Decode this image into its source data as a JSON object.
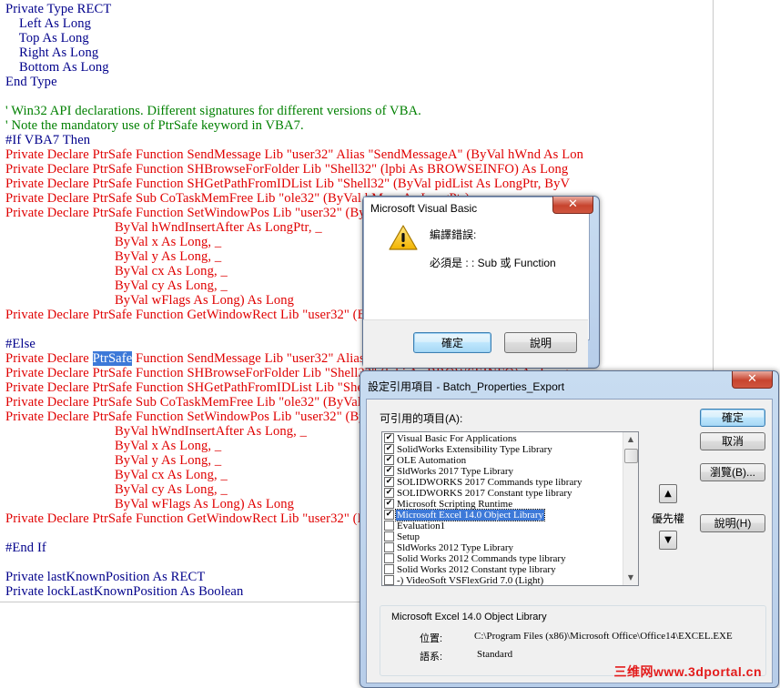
{
  "code": {
    "lines": [
      {
        "segs": [
          {
            "t": "Private Type RECT",
            "c": "blue"
          }
        ]
      },
      {
        "segs": [
          {
            "t": "    Left As Long",
            "c": "blue"
          }
        ]
      },
      {
        "segs": [
          {
            "t": "    Top As Long",
            "c": "blue"
          }
        ]
      },
      {
        "segs": [
          {
            "t": "    Right As Long",
            "c": "blue"
          }
        ]
      },
      {
        "segs": [
          {
            "t": "    Bottom As Long",
            "c": "blue"
          }
        ]
      },
      {
        "segs": [
          {
            "t": "End Type",
            "c": "blue"
          }
        ]
      },
      {
        "segs": []
      },
      {
        "segs": [
          {
            "t": "' Win32 API declarations. Different signatures for different versions of VBA.",
            "c": "green"
          }
        ]
      },
      {
        "segs": [
          {
            "t": "' Note the mandatory use of PtrSafe keyword in VBA7.",
            "c": "green"
          }
        ]
      },
      {
        "segs": [
          {
            "t": "#If VBA7 Then",
            "c": "blue"
          }
        ]
      },
      {
        "segs": [
          {
            "t": "Private Declare PtrSafe Function SendMessage Lib \"user32\" Alias \"SendMessageA\" (ByVal hWnd As Lon",
            "c": "red"
          }
        ]
      },
      {
        "segs": [
          {
            "t": "Private Declare PtrSafe Function SHBrowseForFolder Lib \"Shell32\" (lpbi As BROWSEINFO) As Long",
            "c": "red"
          }
        ]
      },
      {
        "segs": [
          {
            "t": "Private Declare PtrSafe Function SHGetPathFromIDList Lib \"Shell32\" (ByVal pidList As LongPtr, ByV",
            "c": "red"
          }
        ]
      },
      {
        "segs": [
          {
            "t": "Private Declare PtrSafe Sub CoTaskMemFree Lib \"ole32\" (ByVal hMem As LongPtr)",
            "c": "red"
          }
        ]
      },
      {
        "segs": [
          {
            "t": "Private Declare PtrSafe Function SetWindowPos Lib \"user32\" (ByVal hWnd As LongPtr, _",
            "c": "red"
          }
        ]
      },
      {
        "segs": [
          {
            "t": "                                ByVal hWndInsertAfter As LongPtr, _",
            "c": "red"
          }
        ]
      },
      {
        "segs": [
          {
            "t": "                                ByVal x As Long, _",
            "c": "red"
          }
        ]
      },
      {
        "segs": [
          {
            "t": "                                ByVal y As Long, _",
            "c": "red"
          }
        ]
      },
      {
        "segs": [
          {
            "t": "                                ByVal cx As Long, _",
            "c": "red"
          }
        ]
      },
      {
        "segs": [
          {
            "t": "                                ByVal cy As Long, _",
            "c": "red"
          }
        ]
      },
      {
        "segs": [
          {
            "t": "                                ByVal wFlags As Long) As Long",
            "c": "red"
          }
        ]
      },
      {
        "segs": [
          {
            "t": "Private Declare PtrSafe Function GetWindowRect Lib \"user32\" (ByVal hWnd As LongPtr, lpRect As",
            "c": "red"
          }
        ]
      },
      {
        "segs": []
      },
      {
        "segs": [
          {
            "t": "#Else",
            "c": "blue"
          }
        ]
      },
      {
        "segs": [
          {
            "t": "Private Declare ",
            "c": "red"
          },
          {
            "t": "PtrSafe",
            "c": "red",
            "hl": true
          },
          {
            "t": " Function SendMessage Lib \"user32\" Alias \"SendMessageA\" (ByVal hWnd As Lon",
            "c": "red"
          }
        ]
      },
      {
        "segs": [
          {
            "t": "Private Declare PtrSafe Function SHBrowseForFolder Lib \"Shell32\" (lpbi As BROWSEINFO) As Long",
            "c": "red"
          }
        ]
      },
      {
        "segs": [
          {
            "t": "Private Declare PtrSafe Function SHGetPathFromIDList Lib \"Shell32\" (ByVal pidList As Long, ByV",
            "c": "red"
          }
        ]
      },
      {
        "segs": [
          {
            "t": "Private Declare PtrSafe Sub CoTaskMemFree Lib \"ole32\" (ByVal hMem As Long)",
            "c": "red"
          }
        ]
      },
      {
        "segs": [
          {
            "t": "Private Declare PtrSafe Function SetWindowPos Lib \"user32\" (ByVal hWnd As Long, _",
            "c": "red"
          }
        ]
      },
      {
        "segs": [
          {
            "t": "                                ByVal hWndInsertAfter As Long, _",
            "c": "red"
          }
        ]
      },
      {
        "segs": [
          {
            "t": "                                ByVal x As Long, _",
            "c": "red"
          }
        ]
      },
      {
        "segs": [
          {
            "t": "                                ByVal y As Long, _",
            "c": "red"
          }
        ]
      },
      {
        "segs": [
          {
            "t": "                                ByVal cx As Long, _",
            "c": "red"
          }
        ]
      },
      {
        "segs": [
          {
            "t": "                                ByVal cy As Long, _",
            "c": "red"
          }
        ]
      },
      {
        "segs": [
          {
            "t": "                                ByVal wFlags As Long) As Long",
            "c": "red"
          }
        ]
      },
      {
        "segs": [
          {
            "t": "Private Declare PtrSafe Function GetWindowRect Lib \"user32\" (ByVal hWnd As Long, lpRect As",
            "c": "red"
          }
        ]
      },
      {
        "segs": []
      },
      {
        "segs": [
          {
            "t": "#End If",
            "c": "blue"
          }
        ]
      },
      {
        "segs": []
      },
      {
        "segs": [
          {
            "t": "Private lastKnownPosition As RECT",
            "c": "blue"
          }
        ]
      },
      {
        "segs": [
          {
            "t": "Private lockLastKnownPosition As Boolean",
            "c": "blue"
          }
        ]
      }
    ]
  },
  "error_dialog": {
    "title": "Microsoft Visual Basic",
    "close": "✕",
    "heading": "編譯錯誤:",
    "message": "必須是 : : Sub 或 Function",
    "ok_label": "確定",
    "help_label": "說明",
    "icon": "warning-icon"
  },
  "references_dialog": {
    "title": "設定引用項目 - Batch_Properties_Export",
    "close": "✕",
    "available_label": "可引用的項目(A):",
    "items": [
      {
        "label": "Visual Basic For Applications",
        "checked": true,
        "selected": false
      },
      {
        "label": "SolidWorks Extensibility Type Library",
        "checked": true,
        "selected": false
      },
      {
        "label": "OLE Automation",
        "checked": true,
        "selected": false
      },
      {
        "label": "SldWorks 2017 Type Library",
        "checked": true,
        "selected": false
      },
      {
        "label": "SOLIDWORKS 2017 Commands type library",
        "checked": true,
        "selected": false
      },
      {
        "label": "SOLIDWORKS 2017 Constant type library",
        "checked": true,
        "selected": false
      },
      {
        "label": "Microsoft Scripting Runtime",
        "checked": true,
        "selected": false
      },
      {
        "label": "Microsoft Excel 14.0 Object Library",
        "checked": true,
        "selected": true
      },
      {
        "label": "Evaluation1",
        "checked": false,
        "selected": false
      },
      {
        "label": "Setup",
        "checked": false,
        "selected": false
      },
      {
        "label": "SldWorks 2012 Type Library",
        "checked": false,
        "selected": false
      },
      {
        "label": "Solid Works 2012 Commands type library",
        "checked": false,
        "selected": false
      },
      {
        "label": "Solid Works 2012 Constant type library",
        "checked": false,
        "selected": false
      },
      {
        "label": "-) VideoSoft VSFlexGrid 7.0 (Light)",
        "checked": false,
        "selected": false
      }
    ],
    "ok_label": "確定",
    "cancel_label": "取消",
    "browse_label": "瀏覽(B)...",
    "help_label": "說明(H)",
    "priority_label": "優先權",
    "priority_up": "▲",
    "priority_down": "▼",
    "scroll_up": "▲",
    "scroll_down": "▼",
    "selected_name": "Microsoft Excel 14.0 Object Library",
    "location_label": "位置:",
    "location_value": "C:\\Program Files (x86)\\Microsoft Office\\Office14\\EXCEL.EXE",
    "language_label": "語系:",
    "language_value": "Standard"
  },
  "watermark": "三维网www.3dportal.cn"
}
